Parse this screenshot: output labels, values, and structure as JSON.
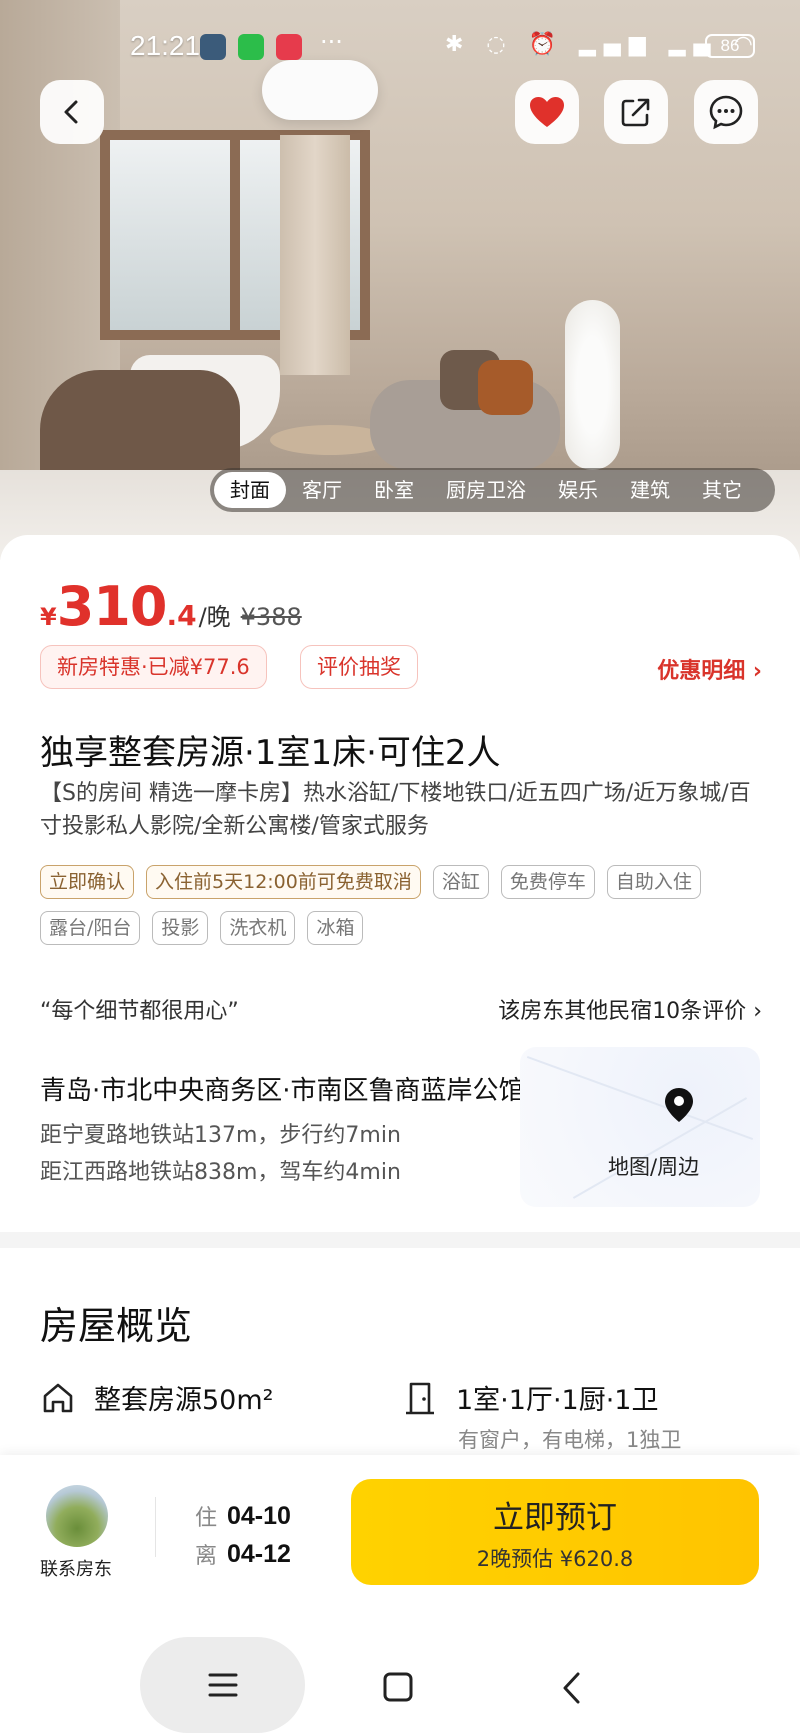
{
  "status": {
    "time": "21:21",
    "battery": "86"
  },
  "hero": {
    "tabs": [
      "封面",
      "客厅",
      "卧室",
      "厨房卫浴",
      "娱乐",
      "建筑",
      "其它"
    ],
    "active_tab": 0
  },
  "price": {
    "currency": "¥",
    "integer": "310",
    "decimal": ".4",
    "unit": "/晚",
    "original": "¥388"
  },
  "promos": {
    "discount": "新房特惠·已减¥77.6",
    "lottery": "评价抽奖",
    "detail": "优惠明细"
  },
  "listing": {
    "title": "独享整套房源·1室1床·可住2人",
    "description": "【S的房间 精选一摩卡房】热水浴缸/下楼地铁口/近五四广场/近万象城/百寸投影私人影院/全新公寓楼/管家式服务",
    "tags": [
      {
        "label": "立即确认",
        "highlight": true
      },
      {
        "label": "入住前5天12:00前可免费取消",
        "highlight": true
      },
      {
        "label": "浴缸",
        "highlight": false
      },
      {
        "label": "免费停车",
        "highlight": false
      },
      {
        "label": "自助入住",
        "highlight": false
      },
      {
        "label": "露台/阳台",
        "highlight": false
      },
      {
        "label": "投影",
        "highlight": false
      },
      {
        "label": "洗衣机",
        "highlight": false
      },
      {
        "label": "冰箱",
        "highlight": false
      }
    ]
  },
  "review": {
    "quote": "“每个细节都很用心”",
    "link": "该房东其他民宿10条评价"
  },
  "location": {
    "title": "青岛·市北中央商务区·市南区鲁商蓝岸公馆",
    "line1": "距宁夏路地铁站137m，步行约7min",
    "line2": "距江西路地铁站838m，驾车约4min",
    "map_label": "地图/周边"
  },
  "overview": {
    "title": "房屋概览",
    "area": "整套房源50m²",
    "rooms": "1室·1厅·1厨·1卫",
    "rooms_sub": "有窗户，有电梯，1独卫"
  },
  "bottom": {
    "contact": "联系房东",
    "checkin_label": "住",
    "checkin_date": "04-10",
    "checkout_label": "离",
    "checkout_date": "04-12",
    "book_label": "立即预订",
    "book_sub": "2晚预估 ¥620.8"
  },
  "colors": {
    "price_red": "#e0312b",
    "book_yellow": "#ffd200"
  }
}
